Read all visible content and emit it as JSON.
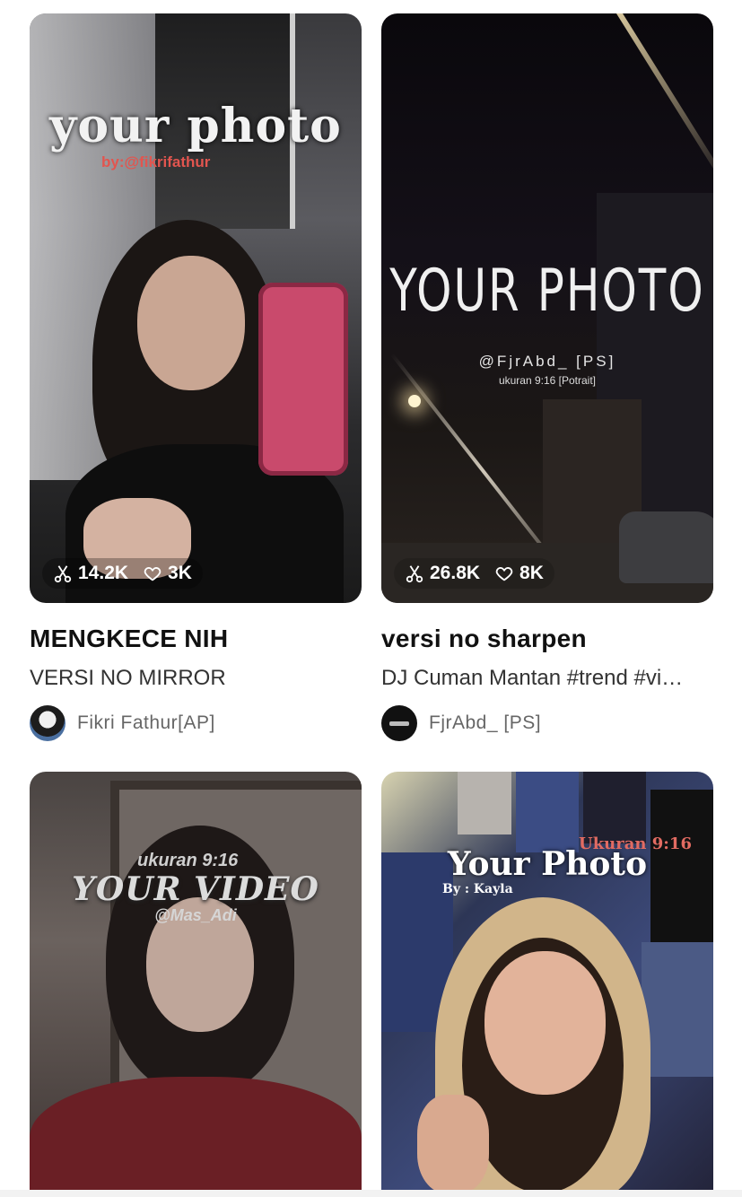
{
  "cards": [
    {
      "overlay_title": "your photo",
      "overlay_credit": "by:@fikrifathur",
      "stats": {
        "uses": "14.2K",
        "likes": "3K"
      },
      "title": "MENGKECE NIH",
      "subtitle": "VERSI NO MIRROR",
      "author": "Fikri Fathur[AP]"
    },
    {
      "overlay_title": "YOUR PHOTO",
      "overlay_credit": "@FjrAbd_ [PS]",
      "overlay_note": "ukuran 9:16 [Potrait]",
      "stats": {
        "uses": "26.8K",
        "likes": "8K"
      },
      "title": "versi no sharpen",
      "subtitle": "DJ Cuman Mantan #trend #vi…",
      "author": "FjrAbd_ [PS]"
    },
    {
      "overlay_note": "ukuran 9:16",
      "overlay_title": "YOUR VIDEO",
      "overlay_credit": "@Mas_Adi"
    },
    {
      "overlay_note": "Ukuran 9:16",
      "overlay_title": "Your Photo",
      "overlay_credit": "By : Kayla"
    }
  ],
  "colors": {
    "card1_bg": "#2a2a2c",
    "card2_bg": "#0d0b10",
    "card3_bg": "#5b5553",
    "card4_bg": "#3a3f63",
    "stats_text": "#ffffff",
    "subtitle_text": "#333333",
    "author_text": "#666666"
  },
  "icons": {
    "uses": "scissors-icon",
    "likes": "heart-icon"
  }
}
